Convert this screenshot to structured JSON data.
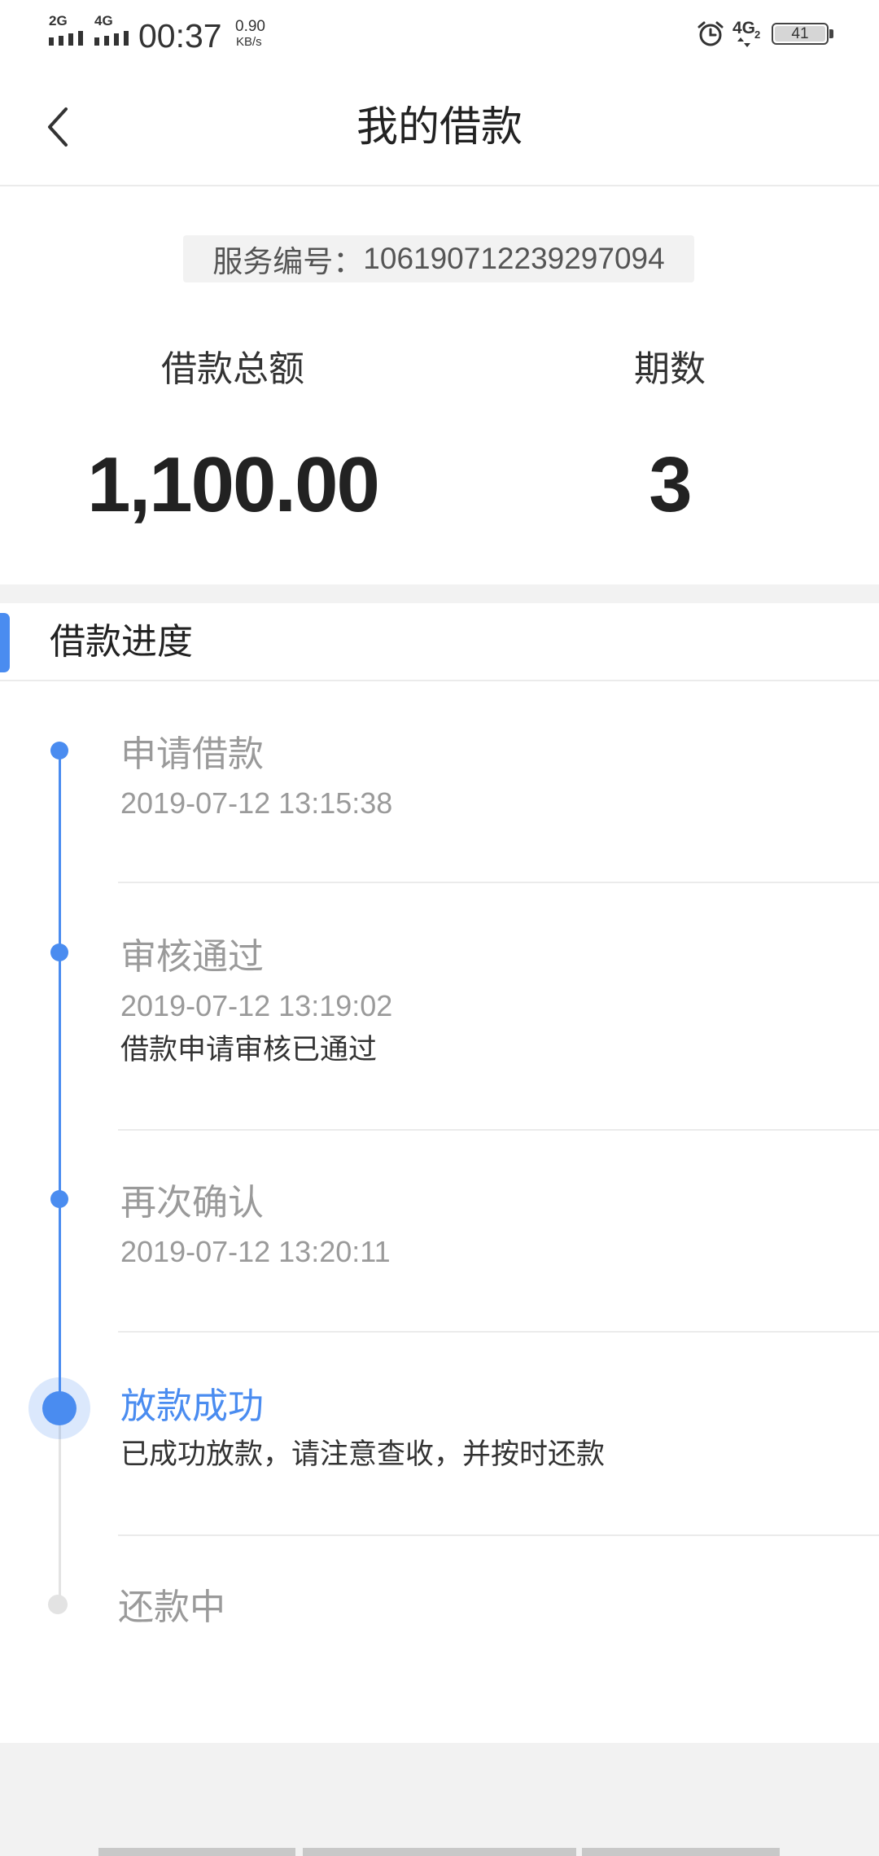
{
  "status_bar": {
    "network1": "2G",
    "network2": "4G",
    "time": "00:37",
    "speed_value": "0.90",
    "speed_unit": "KB/s",
    "right_network": "4G",
    "right_network_sub": "2",
    "battery": "41"
  },
  "header": {
    "title": "我的借款"
  },
  "service": {
    "label": "服务编号：",
    "number": "106190712239297094"
  },
  "summary": {
    "amount_label": "借款总额",
    "amount_value": "1,100.00",
    "periods_label": "期数",
    "periods_value": "3"
  },
  "progress": {
    "section_title": "借款进度",
    "current_step": 3,
    "steps": [
      {
        "title": "申请借款",
        "time": "2019-07-12 13:15:38"
      },
      {
        "title": "审核通过",
        "time": "2019-07-12 13:19:02",
        "note": "借款申请审核已通过"
      },
      {
        "title": "再次确认",
        "time": "2019-07-12 13:20:11"
      },
      {
        "title": "放款成功",
        "note": "已成功放款，请注意查收，并按时还款"
      },
      {
        "title": "还款中"
      }
    ]
  },
  "icons": {
    "back": "chevron-left-icon",
    "alarm": "alarm-icon",
    "signal": "signal-icon",
    "battery": "battery-icon"
  },
  "colors": {
    "accent": "#4a8cf0",
    "text_primary": "#222222",
    "text_secondary": "#9a9a9a",
    "note": "#333333",
    "pending": "#e3e3e3",
    "background": "#f2f2f2"
  }
}
